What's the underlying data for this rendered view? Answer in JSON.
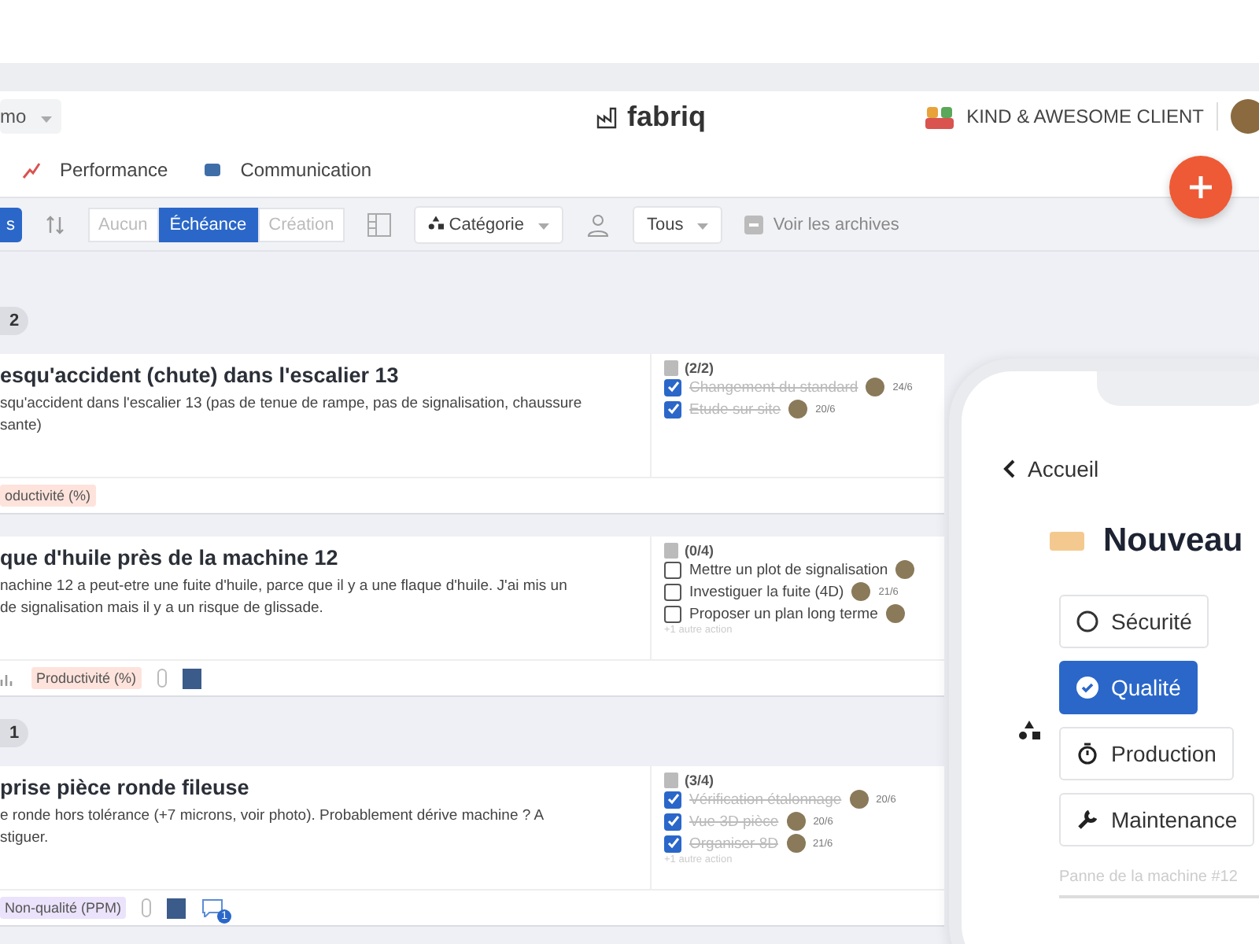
{
  "header": {
    "workspace": "mo",
    "logo": "fabriq",
    "client": "KIND & AWESOME CLIENT"
  },
  "nav": [
    {
      "label": "Performance"
    },
    {
      "label": "Communication"
    }
  ],
  "toolbar": {
    "left_button": "s",
    "sort_options": [
      {
        "label": "Aucun",
        "selected": false
      },
      {
        "label": "Échéance",
        "selected": true
      },
      {
        "label": "Création",
        "selected": false
      }
    ],
    "category": "Catégorie",
    "people": "Tous",
    "archives": "Voir les archives"
  },
  "groups": [
    {
      "badge": "2",
      "cards": [
        {
          "title": "esqu'accident (chute) dans l'escalier 13",
          "description": [
            "squ'accident dans l'escalier 13 (pas de tenue de rampe, pas de signalisation, chaussure",
            "sante)"
          ],
          "progress": "(2/2)",
          "actions": [
            {
              "label": "Changement du standard",
              "checked": true,
              "date": "24/6"
            },
            {
              "label": "Etude sur site",
              "checked": true,
              "date": "20/6"
            }
          ],
          "tag": {
            "label": "oductivité (%)",
            "color": "#fde3dc"
          },
          "chart": false,
          "attachment": false,
          "photo": false
        },
        {
          "title": "que d'huile près de la machine 12",
          "description": [
            "nachine 12 a peut-etre une fuite d'huile, parce que il y a une flaque d'huile. J'ai mis un",
            " de signalisation mais il y a un risque de glissade."
          ],
          "progress": "(0/4)",
          "actions": [
            {
              "label": "Mettre un plot de signalisation",
              "checked": false
            },
            {
              "label": "Investiguer la fuite (4D)",
              "checked": false,
              "date": "21/6"
            },
            {
              "label": "Proposer un plan long terme",
              "checked": false
            }
          ],
          "more": "+1 autre action",
          "tag": {
            "label": "Productivité (%)",
            "color": "#fde3dc"
          },
          "chart": true,
          "attachment": true,
          "photo": true
        }
      ]
    },
    {
      "badge": "1",
      "cards": [
        {
          "title": "prise pièce ronde fileuse",
          "description": [
            "e ronde hors tolérance (+7 microns, voir photo). Probablement dérive machine ? A",
            "stiguer."
          ],
          "progress": "(3/4)",
          "actions": [
            {
              "label": "Vérification étalonnage",
              "checked": true,
              "date": "20/6"
            },
            {
              "label": "Vue 3D pièce",
              "checked": true,
              "date": "20/6"
            },
            {
              "label": "Organiser 8D",
              "checked": true,
              "date": "21/6"
            }
          ],
          "more": "+1 autre action",
          "tag": {
            "label": "Non-qualité (PPM)",
            "color": "#ebe3fb"
          },
          "chart": false,
          "attachment": true,
          "photo": true,
          "comments": "1"
        }
      ]
    }
  ],
  "phone": {
    "back": "Accueil",
    "title": "Nouveau",
    "options": [
      {
        "label": "Sécurité",
        "selected": false
      },
      {
        "label": "Qualité",
        "selected": true
      },
      {
        "label": "Production",
        "selected": false
      },
      {
        "label": "Maintenance",
        "selected": false
      }
    ],
    "placeholder": "Panne de la machine #12"
  }
}
